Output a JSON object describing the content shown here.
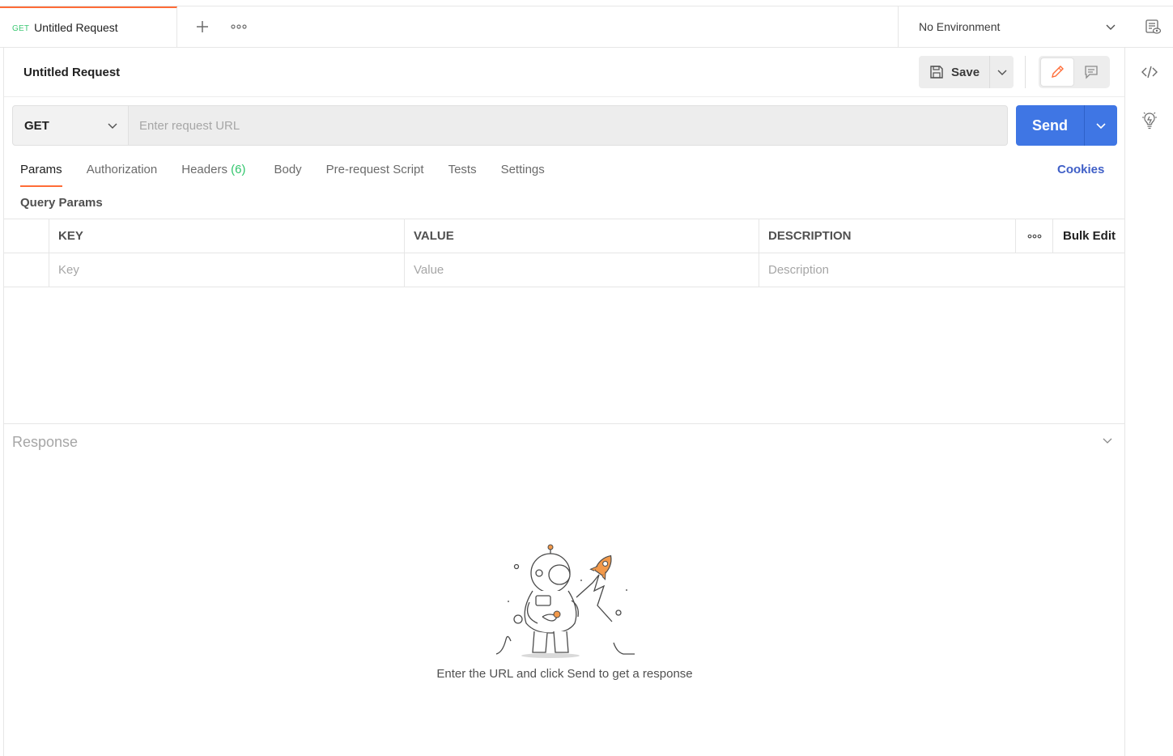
{
  "tabbar": {
    "active_tab": {
      "method": "GET",
      "title": "Untitled Request"
    },
    "environment": "No Environment"
  },
  "header": {
    "title": "Untitled Request",
    "save_label": "Save"
  },
  "urlbar": {
    "method": "GET",
    "placeholder": "Enter request URL",
    "value": "",
    "send_label": "Send"
  },
  "request_tabs": [
    {
      "label": "Params",
      "active": true
    },
    {
      "label": "Authorization"
    },
    {
      "label": "Headers",
      "count": "(6)"
    },
    {
      "label": "Body"
    },
    {
      "label": "Pre-request Script"
    },
    {
      "label": "Tests"
    },
    {
      "label": "Settings"
    }
  ],
  "cookies_label": "Cookies",
  "query_params": {
    "label": "Query Params",
    "columns": {
      "key": "KEY",
      "value": "VALUE",
      "description": "DESCRIPTION"
    },
    "bulk_edit": "Bulk Edit",
    "placeholders": {
      "key": "Key",
      "value": "Value",
      "description": "Description"
    }
  },
  "response": {
    "title": "Response",
    "empty_message": "Enter the URL and click Send to get a response"
  },
  "colors": {
    "accent": "#ff6c37",
    "send": "#3f76e4",
    "method_get": "#0cbb52",
    "link": "#3f5fc7"
  }
}
